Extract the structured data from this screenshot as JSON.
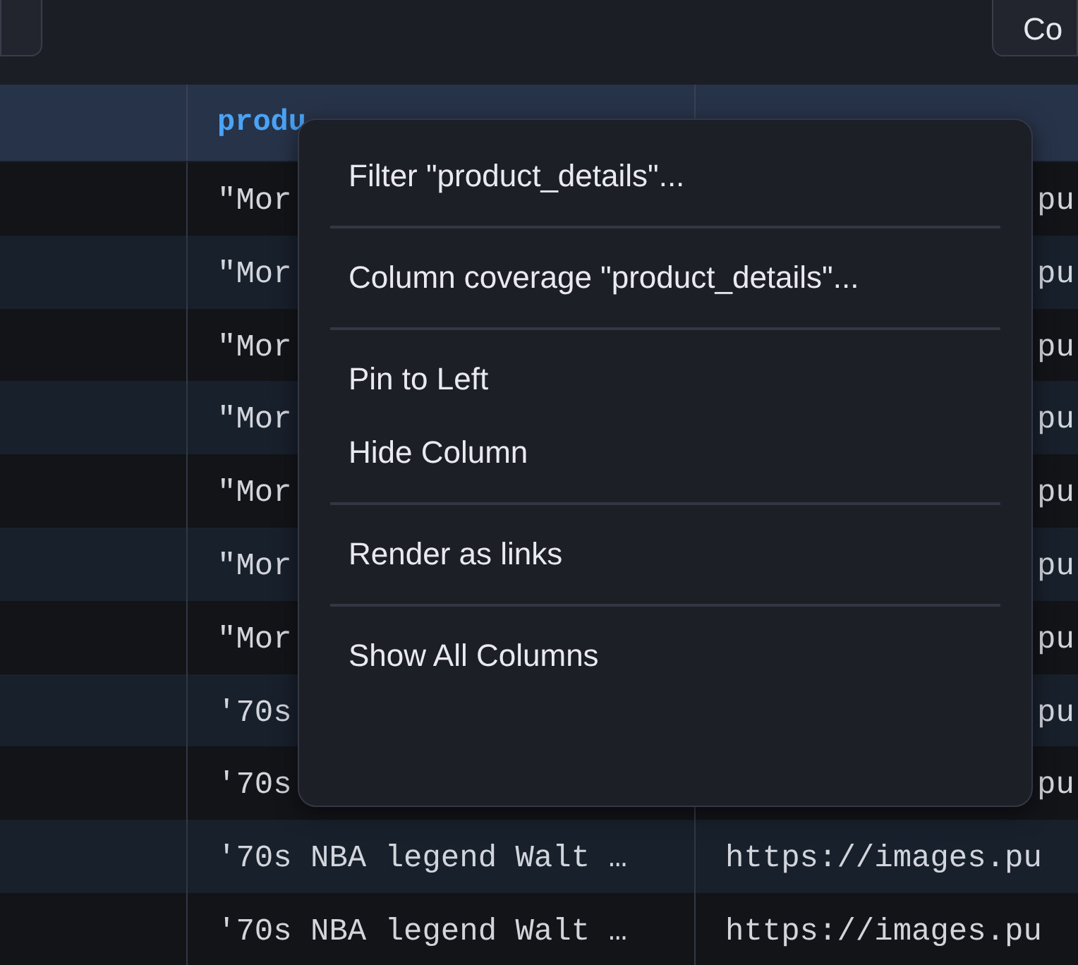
{
  "toolbar": {
    "right_button": "Co"
  },
  "table": {
    "columns": [
      {
        "label": "produ"
      }
    ],
    "rows": [
      {
        "cells": [
          "\"Mor",
          "pu"
        ]
      },
      {
        "cells": [
          "\"Mor",
          "pu"
        ]
      },
      {
        "cells": [
          "\"Mor",
          "pu"
        ]
      },
      {
        "cells": [
          "\"Mor",
          "pu"
        ]
      },
      {
        "cells": [
          "\"Mor",
          "pu"
        ]
      },
      {
        "cells": [
          "\"Mor",
          "pu"
        ]
      },
      {
        "cells": [
          "\"Mor",
          "pu"
        ]
      },
      {
        "cells": [
          "'70s",
          "pu"
        ]
      },
      {
        "cells": [
          "'70s",
          "pu"
        ]
      },
      {
        "cells": [
          "'70s NBA legend Walt …",
          "https://images.pu"
        ]
      },
      {
        "cells": [
          "'70s NBA legend Walt …",
          "https://images.pu"
        ]
      }
    ]
  },
  "context_menu": {
    "groups": [
      [
        "Filter \"product_details\"..."
      ],
      [
        "Column coverage \"product_details\"..."
      ],
      [
        "Pin to Left",
        "Hide Column"
      ],
      [
        "Render as links"
      ],
      [
        "Show All Columns"
      ]
    ]
  }
}
